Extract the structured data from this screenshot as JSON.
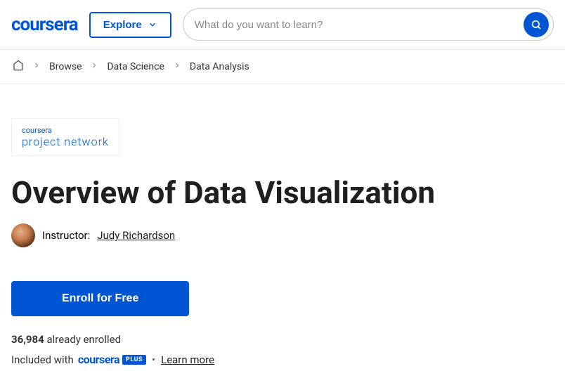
{
  "header": {
    "logo": "coursera",
    "explore": "Explore",
    "search_placeholder": "What do you want to learn?"
  },
  "breadcrumb": {
    "items": [
      "Browse",
      "Data Science",
      "Data Analysis"
    ]
  },
  "provider": {
    "line1": "coursera",
    "line2": "project network"
  },
  "course": {
    "title": "Overview of Data Visualization",
    "instructor_label": "Instructor:",
    "instructor_name": "Judy Richardson",
    "enroll_label": "Enroll for Free",
    "enrolled_count": "36,984",
    "enrolled_suffix": " already enrolled",
    "included_prefix": "Included with",
    "plus_logo": "coursera",
    "plus_tag": "PLUS",
    "learn_more": "Learn more"
  }
}
